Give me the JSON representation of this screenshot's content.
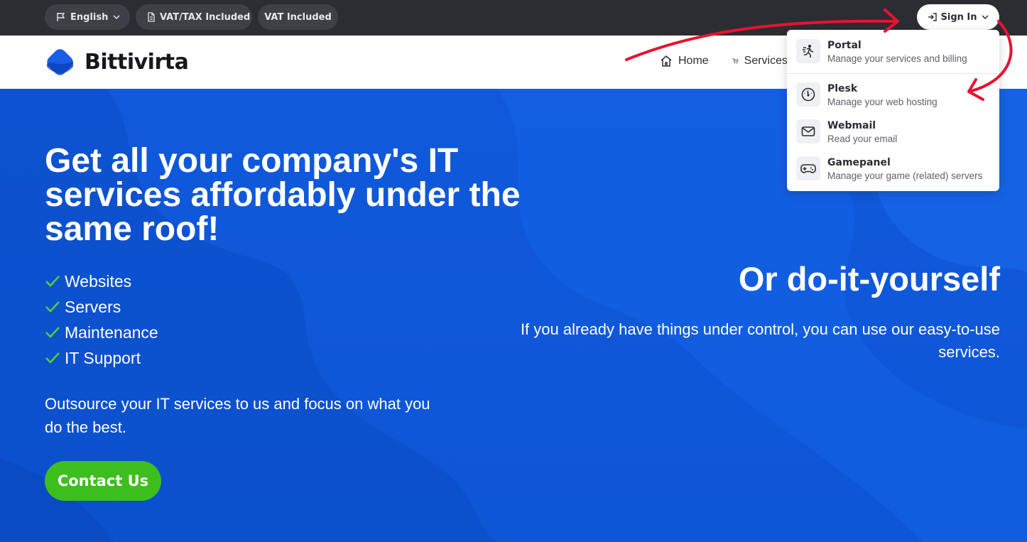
{
  "topbar": {
    "language": "English",
    "vat_tax": "VAT/TAX Included",
    "vat": "VAT Included",
    "sign_in": "Sign In"
  },
  "brand": {
    "name": "Bittivirta"
  },
  "nav": {
    "home": "Home",
    "services": "Services"
  },
  "hero": {
    "title": "Get all your company's IT services affordably under the same roof!",
    "checklist": [
      "Websites",
      "Servers",
      "Maintenance",
      "IT Support"
    ],
    "text": "Outsource your IT services to us and focus on what you do the best.",
    "contact_button": "Contact Us",
    "diy_title": "Or do-it-yourself",
    "diy_text": "If you already have things under control, you can use our easy-to-use services."
  },
  "dropdown": {
    "items": [
      {
        "title": "Portal",
        "subtitle": "Manage your services and billing",
        "icon": "runner-icon"
      },
      {
        "title": "Plesk",
        "subtitle": "Manage your web hosting",
        "icon": "gauge-icon"
      },
      {
        "title": "Webmail",
        "subtitle": "Read your email",
        "icon": "mail-icon"
      },
      {
        "title": "Gamepanel",
        "subtitle": "Manage your game (related) servers",
        "icon": "gamepad-icon"
      }
    ]
  },
  "colors": {
    "topbar": "#2b2d33",
    "hero_blue": "#0e55d8",
    "contact_green": "#3cbf1d",
    "check_green": "#4cd137",
    "annotation_red": "#e8132f"
  }
}
